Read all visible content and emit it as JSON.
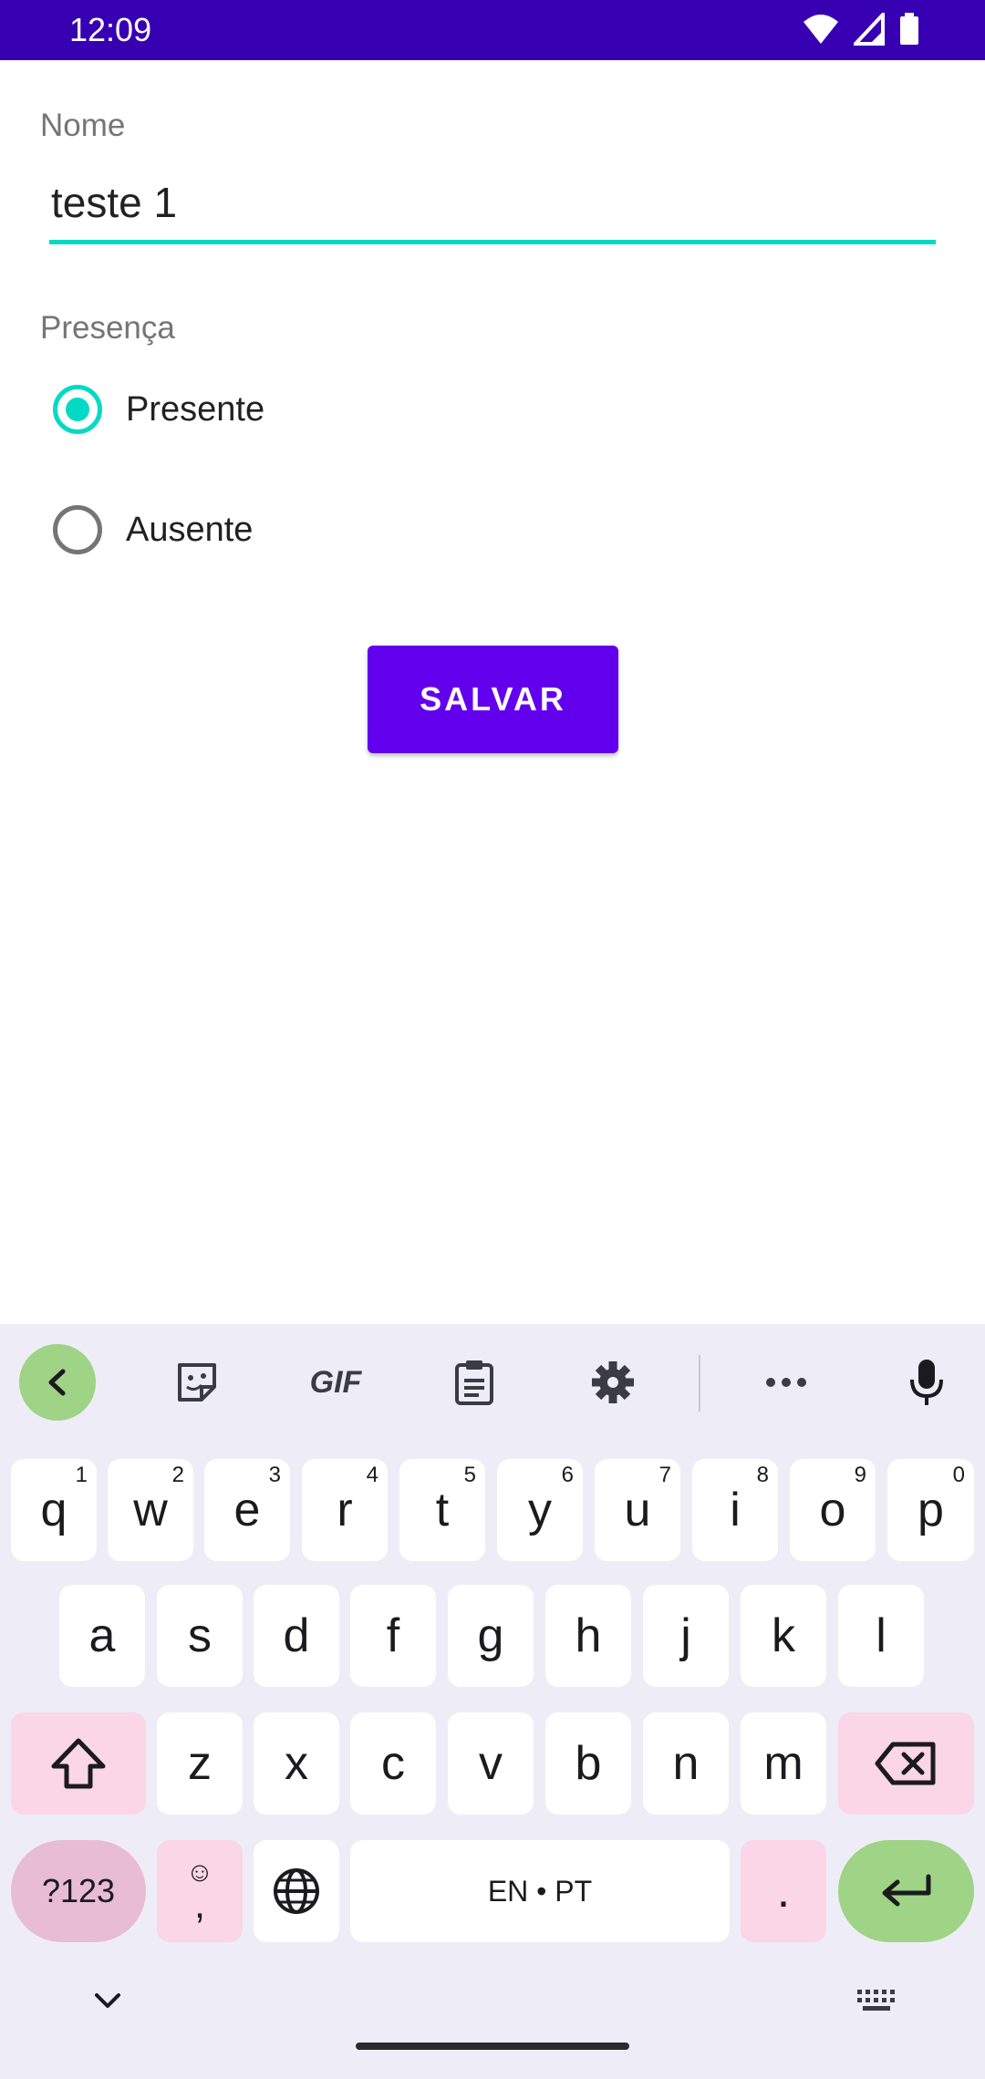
{
  "status_bar": {
    "time": "12:09"
  },
  "form": {
    "name_label": "Nome",
    "name_value": "teste 1",
    "presence_label": "Presença",
    "options": [
      {
        "label": "Presente",
        "checked": true
      },
      {
        "label": "Ausente",
        "checked": false
      }
    ],
    "save_label": "SALVAR"
  },
  "colors": {
    "status_bar": "#3700b3",
    "primary": "#6200ee",
    "accent": "#03dac5"
  },
  "keyboard": {
    "toolbar_icons": [
      "chevron-left-icon",
      "sticker-icon",
      "gif-icon",
      "clipboard-icon",
      "settings-icon",
      "more-icon",
      "mic-icon"
    ],
    "toolbar_gif": "GIF",
    "row1": [
      {
        "k": "q",
        "h": "1"
      },
      {
        "k": "w",
        "h": "2"
      },
      {
        "k": "e",
        "h": "3"
      },
      {
        "k": "r",
        "h": "4"
      },
      {
        "k": "t",
        "h": "5"
      },
      {
        "k": "y",
        "h": "6"
      },
      {
        "k": "u",
        "h": "7"
      },
      {
        "k": "i",
        "h": "8"
      },
      {
        "k": "o",
        "h": "9"
      },
      {
        "k": "p",
        "h": "0"
      }
    ],
    "row2": [
      "a",
      "s",
      "d",
      "f",
      "g",
      "h",
      "j",
      "k",
      "l"
    ],
    "row3": [
      "z",
      "x",
      "c",
      "v",
      "b",
      "n",
      "m"
    ],
    "symbols_label": "?123",
    "emoji_comma": ",",
    "space_label": "EN • PT",
    "period": "."
  }
}
